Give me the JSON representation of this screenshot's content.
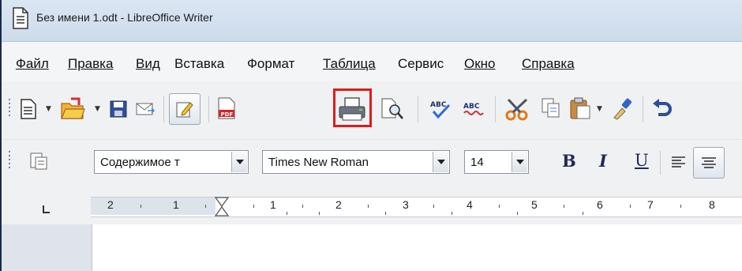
{
  "window": {
    "title": "Без имени 1.odt - LibreOffice Writer"
  },
  "menu": [
    {
      "label": "Файл"
    },
    {
      "label": "Правка"
    },
    {
      "label": "Вид"
    },
    {
      "label": "Вставка"
    },
    {
      "label": "Формат"
    },
    {
      "label": "Таблица"
    },
    {
      "label": "Сервис"
    },
    {
      "label": "Окно"
    },
    {
      "label": "Справка"
    }
  ],
  "toolbar_standard": {
    "icons": [
      "new-document-icon",
      "open-folder-icon",
      "save-icon",
      "email-icon",
      "edit-mode-icon",
      "export-pdf-icon",
      "print-icon",
      "print-preview-icon",
      "spellcheck-icon",
      "autospellcheck-icon",
      "cut-icon",
      "copy-icon",
      "paste-icon",
      "clone-formatting-icon",
      "undo-icon"
    ],
    "highlighted": "print-icon",
    "highlight_color": "#e11a1a"
  },
  "toolbar_formatting": {
    "paragraph_style": "Содержимое т",
    "font_name": "Times New Roman",
    "font_size": "14",
    "bold_label": "B",
    "italic_label": "I",
    "underline_label": "U"
  },
  "ruler": {
    "labels": [
      "2",
      "1",
      "1",
      "2",
      "3",
      "4",
      "5",
      "6",
      "7",
      "8"
    ]
  }
}
